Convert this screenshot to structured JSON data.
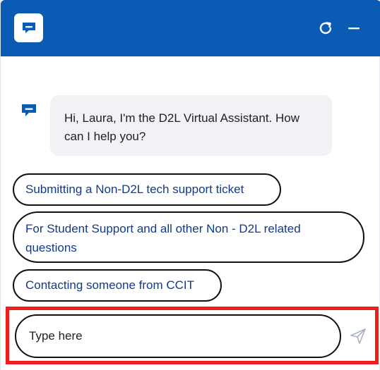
{
  "header": {
    "logo_icon": "chat-bubble-icon",
    "refresh_icon": "refresh-icon",
    "minimize_icon": "minimize-icon",
    "background_color": "#0a5bb4"
  },
  "conversation": {
    "bot_icon": "chat-bubble-icon",
    "messages": [
      {
        "sender": "bot",
        "text": "Hi, Laura, I'm the D2L Virtual Assistant. How can I help you?"
      }
    ]
  },
  "quick_replies": [
    {
      "label": "Submitting a Non-D2L tech support ticket"
    },
    {
      "label": "For Student Support and all other Non - D2L related questions"
    },
    {
      "label": "Contacting someone from CCIT"
    }
  ],
  "composer": {
    "placeholder": "Type here",
    "value": "",
    "send_icon": "send-icon",
    "highlight_color": "#ef1c1c"
  }
}
